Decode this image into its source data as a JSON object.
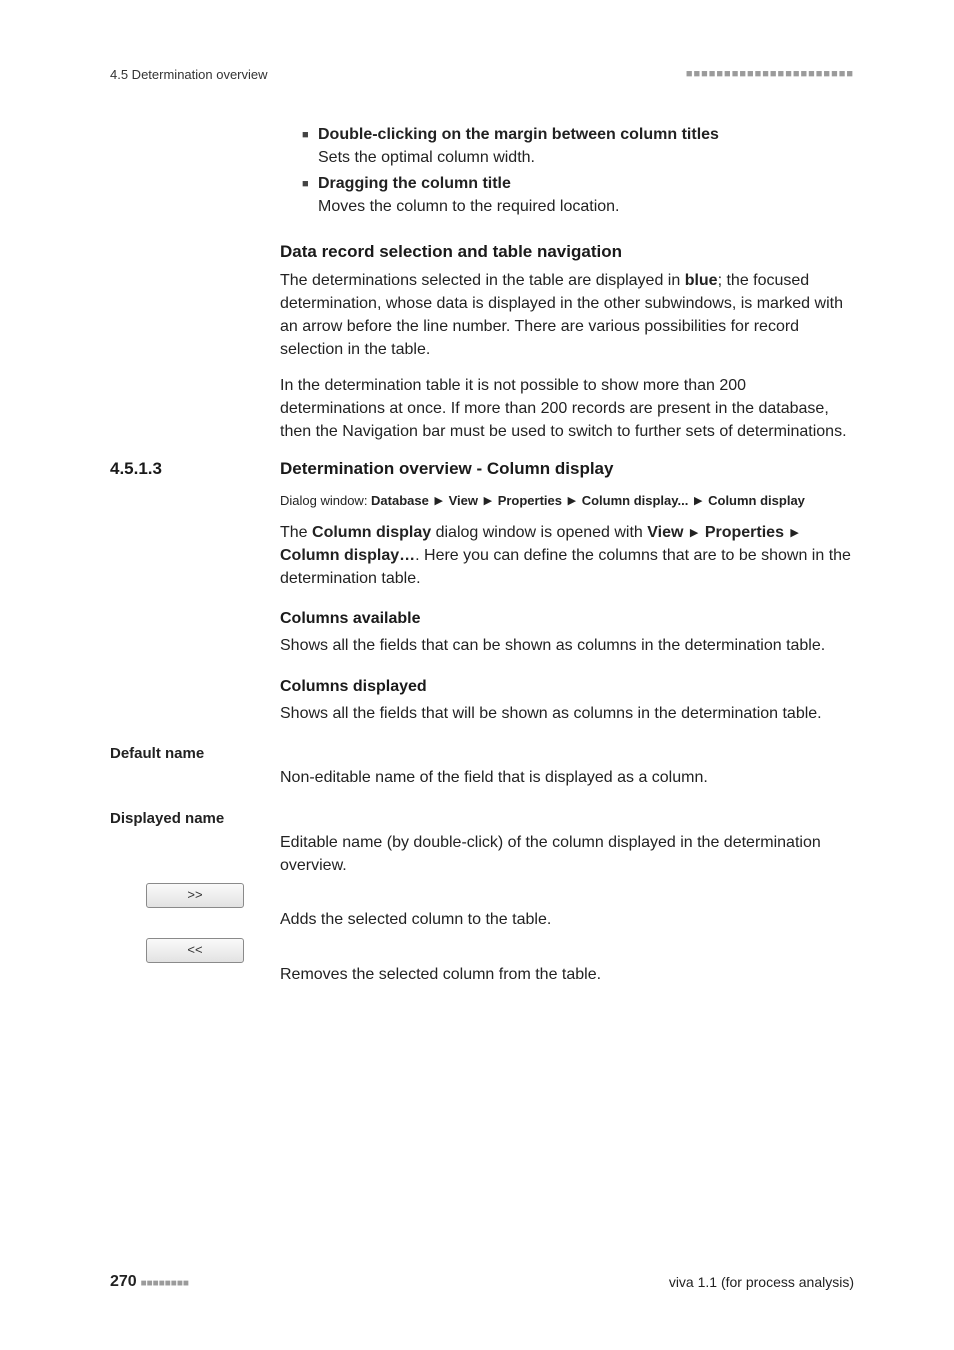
{
  "header": {
    "left": "4.5 Determination overview",
    "dots": "■■■■■■■■■■■■■■■■■■■■■■"
  },
  "bullets": [
    {
      "title": "Double-clicking on the margin between column titles",
      "body": "Sets the optimal column width."
    },
    {
      "title": "Dragging the column title",
      "body": "Moves the column to the required location."
    }
  ],
  "dr": {
    "heading": "Data record selection and table navigation",
    "p1a": "The determinations selected in the table are displayed in ",
    "p1b": "blue",
    "p1c": "; the focused determination, whose data is displayed in the other subwindows, is marked with an arrow before the line number. There are various possibilities for record selection in the table.",
    "p2": "In the determination table it is not possible to show more than 200 determinations at once. If more than 200 records are present in the database, then the Navigation bar must be used to switch to further sets of determinations."
  },
  "section": {
    "num": "4.5.1.3",
    "title": "Determination overview - Column display"
  },
  "dialog": {
    "label": "Dialog window: ",
    "p1": "Database",
    "p2": "View",
    "p3": "Properties",
    "p4": "Column display...",
    "p5": "Column display"
  },
  "cd": {
    "s1a": "The ",
    "s1b": "Column display",
    "s1c": " dialog window is opened with ",
    "s1d": "View",
    "s1e": "Properties",
    "s1f": "Column display…",
    "s1g": ". Here you can define the columns that are to be shown in the determination table."
  },
  "ca": {
    "heading": "Columns available",
    "body": "Shows all the fields that can be shown as columns in the determination table."
  },
  "cdisp": {
    "heading": "Columns displayed",
    "body": "Shows all the fields that will be shown as columns in the determination table."
  },
  "defname": {
    "label": "Default name",
    "body": "Non-editable name of the field that is displayed as a column."
  },
  "dispname": {
    "label": "Displayed name",
    "body": "Editable name (by double-click) of the column displayed in the determination overview."
  },
  "btns": {
    "add": ">>",
    "remove": "<<",
    "add_desc": "Adds the selected column to the table.",
    "remove_desc": "Removes the selected column from the table."
  },
  "footer": {
    "page": "270",
    "dots": "■■■■■■■■",
    "right": "viva 1.1 (for process analysis)"
  },
  "tri": "▶",
  "square": "■"
}
